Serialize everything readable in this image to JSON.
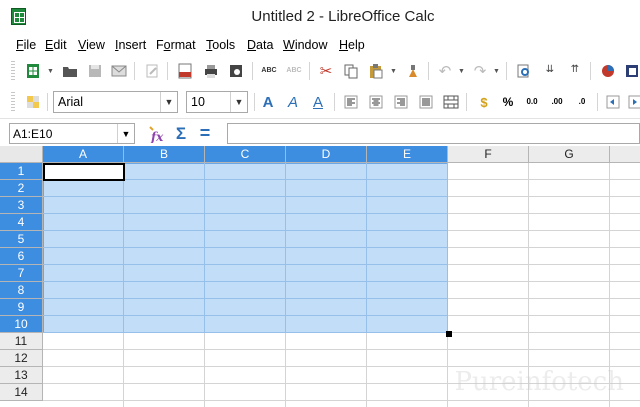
{
  "window": {
    "title": "Untitled 2 - LibreOffice Calc"
  },
  "menu": [
    {
      "label": "File",
      "accel": "F"
    },
    {
      "label": "Edit",
      "accel": "E"
    },
    {
      "label": "View",
      "accel": "V"
    },
    {
      "label": "Insert",
      "accel": "I"
    },
    {
      "label": "Format",
      "accel": "o"
    },
    {
      "label": "Tools",
      "accel": "T"
    },
    {
      "label": "Data",
      "accel": "D"
    },
    {
      "label": "Window",
      "accel": "W"
    },
    {
      "label": "Help",
      "accel": "H"
    }
  ],
  "formatting": {
    "font_name": "Arial",
    "font_size": "10"
  },
  "formula_bar": {
    "name_box": "A1:E10",
    "formula": "",
    "sum_symbol": "Σ",
    "equals_symbol": "="
  },
  "grid": {
    "columns": [
      "A",
      "B",
      "C",
      "D",
      "E",
      "F",
      "G"
    ],
    "rows": [
      "1",
      "2",
      "3",
      "4",
      "5",
      "6",
      "7",
      "8",
      "9",
      "10",
      "11",
      "12",
      "13",
      "14"
    ],
    "selected_range": "A1:E10",
    "active_cell": "A1"
  },
  "watermark": "Pureinfotech",
  "colors": {
    "selection_header": "#3d8de0",
    "selection_fill": "#b8d7f5",
    "app_green": "#1f8a3b"
  }
}
